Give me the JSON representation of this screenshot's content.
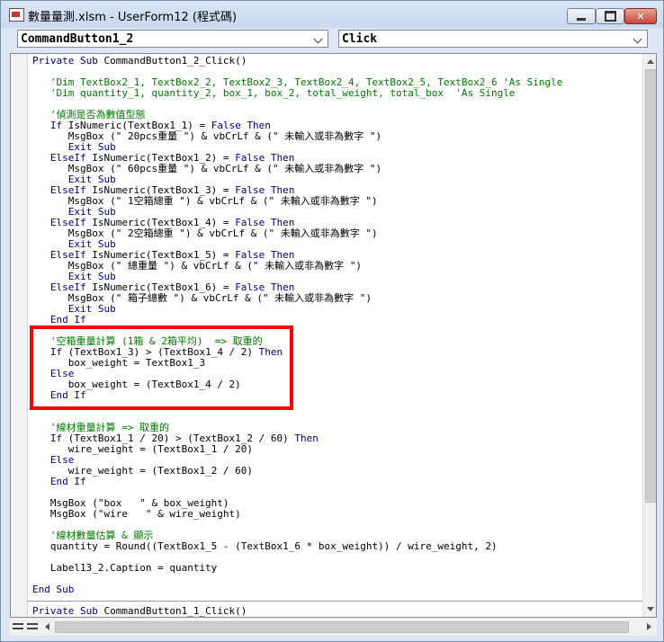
{
  "window": {
    "title": "數量量測.xlsm - UserForm12 (程式碼)",
    "min_icon": "minimize-icon",
    "max_icon": "maximize-icon",
    "close_icon": "close-icon",
    "close_glyph": "✕"
  },
  "object_dropdown": {
    "value": "CommandButton1_2"
  },
  "procedure_dropdown": {
    "value": "Click"
  },
  "code": [
    {
      "indent": 0,
      "parts": [
        {
          "k": "kw",
          "t": "Private Sub "
        },
        {
          "k": "",
          "t": "CommandButton1_2_Click()"
        }
      ]
    },
    {
      "indent": 0,
      "parts": []
    },
    {
      "indent": 1,
      "parts": [
        {
          "k": "cm",
          "t": "'Dim TextBox2_1, TextBox2_2, TextBox2_3, TextBox2_4, TextBox2_5, TextBox2_6 'As Single"
        }
      ]
    },
    {
      "indent": 1,
      "parts": [
        {
          "k": "cm",
          "t": "'Dim quantity_1, quantity_2, box_1, box_2, total_weight, total_box  'As Single"
        }
      ]
    },
    {
      "indent": 0,
      "parts": []
    },
    {
      "indent": 1,
      "parts": [
        {
          "k": "cm",
          "t": "'偵測是否為數值型態"
        }
      ]
    },
    {
      "indent": 1,
      "parts": [
        {
          "k": "kw",
          "t": "If "
        },
        {
          "k": "",
          "t": "IsNumeric(TextBox1_1) = "
        },
        {
          "k": "kw",
          "t": "False Then"
        }
      ]
    },
    {
      "indent": 2,
      "parts": [
        {
          "k": "",
          "t": "MsgBox (\" 20pcs重量 \") & vbCrLf & (\" 未輸入或非為數字 \")"
        }
      ]
    },
    {
      "indent": 2,
      "parts": [
        {
          "k": "kw",
          "t": "Exit Sub"
        }
      ]
    },
    {
      "indent": 1,
      "parts": [
        {
          "k": "kw",
          "t": "ElseIf "
        },
        {
          "k": "",
          "t": "IsNumeric(TextBox1_2) = "
        },
        {
          "k": "kw",
          "t": "False Then"
        }
      ]
    },
    {
      "indent": 2,
      "parts": [
        {
          "k": "",
          "t": "MsgBox (\" 60pcs重量 \") & vbCrLf & (\" 未輸入或非為數字 \")"
        }
      ]
    },
    {
      "indent": 2,
      "parts": [
        {
          "k": "kw",
          "t": "Exit Sub"
        }
      ]
    },
    {
      "indent": 1,
      "parts": [
        {
          "k": "kw",
          "t": "ElseIf "
        },
        {
          "k": "",
          "t": "IsNumeric(TextBox1_3) = "
        },
        {
          "k": "kw",
          "t": "False Then"
        }
      ]
    },
    {
      "indent": 2,
      "parts": [
        {
          "k": "",
          "t": "MsgBox (\" 1空箱總重 \") & vbCrLf & (\" 未輸入或非為數字 \")"
        }
      ]
    },
    {
      "indent": 2,
      "parts": [
        {
          "k": "kw",
          "t": "Exit Sub"
        }
      ]
    },
    {
      "indent": 1,
      "parts": [
        {
          "k": "kw",
          "t": "ElseIf "
        },
        {
          "k": "",
          "t": "IsNumeric(TextBox1_4) = "
        },
        {
          "k": "kw",
          "t": "False Then"
        }
      ]
    },
    {
      "indent": 2,
      "parts": [
        {
          "k": "",
          "t": "MsgBox (\" 2空箱總重 \") & vbCrLf & (\" 未輸入或非為數字 \")"
        }
      ]
    },
    {
      "indent": 2,
      "parts": [
        {
          "k": "kw",
          "t": "Exit Sub"
        }
      ]
    },
    {
      "indent": 1,
      "parts": [
        {
          "k": "kw",
          "t": "ElseIf "
        },
        {
          "k": "",
          "t": "IsNumeric(TextBox1_5) = "
        },
        {
          "k": "kw",
          "t": "False Then"
        }
      ]
    },
    {
      "indent": 2,
      "parts": [
        {
          "k": "",
          "t": "MsgBox (\" 總重量 \") & vbCrLf & (\" 未輸入或非為數字 \")"
        }
      ]
    },
    {
      "indent": 2,
      "parts": [
        {
          "k": "kw",
          "t": "Exit Sub"
        }
      ]
    },
    {
      "indent": 1,
      "parts": [
        {
          "k": "kw",
          "t": "ElseIf "
        },
        {
          "k": "",
          "t": "IsNumeric(TextBox1_6) = "
        },
        {
          "k": "kw",
          "t": "False Then"
        }
      ]
    },
    {
      "indent": 2,
      "parts": [
        {
          "k": "",
          "t": "MsgBox (\" 箱子總數 \") & vbCrLf & (\" 未輸入或非為數字 \")"
        }
      ]
    },
    {
      "indent": 2,
      "parts": [
        {
          "k": "kw",
          "t": "Exit Sub"
        }
      ]
    },
    {
      "indent": 1,
      "parts": [
        {
          "k": "kw",
          "t": "End If"
        }
      ]
    },
    {
      "indent": 0,
      "parts": []
    },
    {
      "indent": 1,
      "parts": [
        {
          "k": "cm",
          "t": "'空箱重量計算 (1箱 & 2箱平均)  => 取重的"
        }
      ]
    },
    {
      "indent": 1,
      "parts": [
        {
          "k": "kw",
          "t": "If "
        },
        {
          "k": "",
          "t": "(TextBox1_3) > (TextBox1_4 / 2) "
        },
        {
          "k": "kw",
          "t": "Then"
        }
      ]
    },
    {
      "indent": 2,
      "parts": [
        {
          "k": "",
          "t": "box_weight = TextBox1_3"
        }
      ]
    },
    {
      "indent": 1,
      "parts": [
        {
          "k": "kw",
          "t": "Else"
        }
      ]
    },
    {
      "indent": 2,
      "parts": [
        {
          "k": "",
          "t": "box_weight = (TextBox1_4 / 2)"
        }
      ]
    },
    {
      "indent": 1,
      "parts": [
        {
          "k": "kw",
          "t": "End If"
        }
      ]
    },
    {
      "indent": 0,
      "parts": []
    },
    {
      "indent": 0,
      "parts": []
    },
    {
      "indent": 1,
      "parts": [
        {
          "k": "cm",
          "t": "'線材重量計算 => 取重的"
        }
      ]
    },
    {
      "indent": 1,
      "parts": [
        {
          "k": "kw",
          "t": "If "
        },
        {
          "k": "",
          "t": "(TextBox1_1 / 20) > (TextBox1_2 / 60) "
        },
        {
          "k": "kw",
          "t": "Then"
        }
      ]
    },
    {
      "indent": 2,
      "parts": [
        {
          "k": "",
          "t": "wire_weight = (TextBox1_1 / 20)"
        }
      ]
    },
    {
      "indent": 1,
      "parts": [
        {
          "k": "kw",
          "t": "Else"
        }
      ]
    },
    {
      "indent": 2,
      "parts": [
        {
          "k": "",
          "t": "wire_weight = (TextBox1_2 / 60)"
        }
      ]
    },
    {
      "indent": 1,
      "parts": [
        {
          "k": "kw",
          "t": "End If"
        }
      ]
    },
    {
      "indent": 0,
      "parts": []
    },
    {
      "indent": 1,
      "parts": [
        {
          "k": "",
          "t": "MsgBox (\"box   \" & box_weight)"
        }
      ]
    },
    {
      "indent": 1,
      "parts": [
        {
          "k": "",
          "t": "MsgBox (\"wire   \" & wire_weight)"
        }
      ]
    },
    {
      "indent": 0,
      "parts": []
    },
    {
      "indent": 1,
      "parts": [
        {
          "k": "cm",
          "t": "'線材數量估算 & 顯示"
        }
      ]
    },
    {
      "indent": 1,
      "parts": [
        {
          "k": "",
          "t": "quantity = Round((TextBox1_5 - (TextBox1_6 * box_weight)) / wire_weight, 2)"
        }
      ]
    },
    {
      "indent": 0,
      "parts": []
    },
    {
      "indent": 1,
      "parts": [
        {
          "k": "",
          "t": "Label13_2.Caption = quantity"
        }
      ]
    },
    {
      "indent": 0,
      "parts": []
    },
    {
      "indent": 0,
      "parts": [
        {
          "k": "kw",
          "t": "End Sub"
        }
      ]
    },
    {
      "indent": 0,
      "parts": [],
      "separator": true
    },
    {
      "indent": 0,
      "parts": [
        {
          "k": "kw",
          "t": "Private Sub "
        },
        {
          "k": "",
          "t": "CommandButton1_1_Click()"
        }
      ]
    }
  ]
}
